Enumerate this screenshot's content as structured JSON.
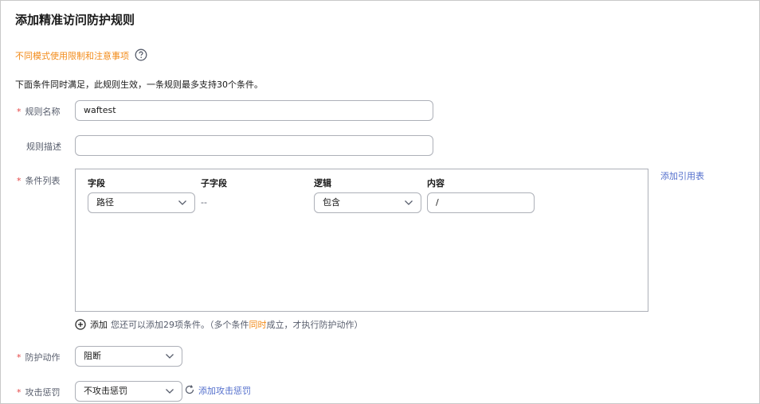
{
  "page": {
    "title": "添加精准访问防护规则",
    "notice_link": "不同模式使用限制和注意事项",
    "description": "下面条件同时满足，此规则生效，一条规则最多支持30个条件。"
  },
  "form": {
    "rule_name": {
      "label": "规则名称",
      "required": true,
      "value": "waftest"
    },
    "rule_desc": {
      "label": "规则描述",
      "required": false,
      "value": ""
    },
    "conditions": {
      "label": "条件列表",
      "required": true,
      "columns": [
        "字段",
        "子字段",
        "逻辑",
        "内容"
      ],
      "rows": [
        {
          "field": "路径",
          "subfield": "--",
          "logic": "包含",
          "content": "/"
        }
      ],
      "add_ref_link": "添加引用表",
      "add_label": "添加",
      "hint_prefix": "您还可以添加29项条件。（多个条件",
      "hint_highlight": "同时",
      "hint_suffix": "成立，才执行防护动作）"
    },
    "action": {
      "label": "防护动作",
      "required": true,
      "value": "阻断"
    },
    "next_row": {
      "label": "攻击惩罚",
      "value": "不攻击惩罚",
      "link": "添加攻击惩罚"
    }
  },
  "colors": {
    "required": "#e54545",
    "accent_orange": "#f28b1a",
    "link": "#526ecc",
    "border": "#adb0b8"
  },
  "icons": [
    "help-icon",
    "chevron-down-icon",
    "plus-circle-icon",
    "refresh-icon"
  ]
}
